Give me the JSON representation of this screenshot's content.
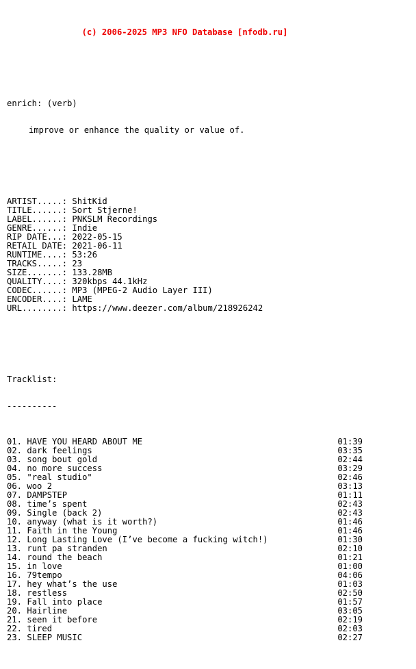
{
  "header": {
    "credit": "(c) 2006-2025 MP3 NFO Database [nfodb.ru]",
    "credit_color": "#ee0000"
  },
  "definition": {
    "word_line": "enrich: (verb)",
    "body_line": "improve or enhance the quality or value of."
  },
  "metadata": {
    "fields": [
      {
        "label": "ARTIST.....: ",
        "value": "ShitKid"
      },
      {
        "label": "TITLE......: ",
        "value": "Sort Stjerne!"
      },
      {
        "label": "LABEL......: ",
        "value": "PNKSLM Recordings"
      },
      {
        "label": "GENRE......: ",
        "value": "Indie"
      },
      {
        "label": "RIP DATE...: ",
        "value": "2022-05-15"
      },
      {
        "label": "RETAIL DATE: ",
        "value": "2021-06-11"
      },
      {
        "label": "RUNTIME....: ",
        "value": "53:26"
      },
      {
        "label": "TRACKS.....: ",
        "value": "23"
      },
      {
        "label": "SIZE.......: ",
        "value": "133.28MB"
      },
      {
        "label": "QUALITY....: ",
        "value": "320kbps 44.1kHz"
      },
      {
        "label": "CODEC......: ",
        "value": "MP3 (MPEG-2 Audio Layer III)"
      },
      {
        "label": "ENCODER....: ",
        "value": "LAME"
      },
      {
        "label": "URL........: ",
        "value": "https://www.deezer.com/album/218926242"
      }
    ]
  },
  "tracklist": {
    "title": "Tracklist:",
    "rule": "----------",
    "tracks": [
      {
        "num": "01. ",
        "name": "HAVE YOU HEARD ABOUT ME",
        "time": "01:39"
      },
      {
        "num": "02. ",
        "name": "dark feelings",
        "time": "03:35"
      },
      {
        "num": "03. ",
        "name": "song bout gold",
        "time": "02:44"
      },
      {
        "num": "04. ",
        "name": "no more success",
        "time": "03:29"
      },
      {
        "num": "05. ",
        "name": "\"real studio\"",
        "time": "02:46"
      },
      {
        "num": "06. ",
        "name": "woo 2",
        "time": "03:13"
      },
      {
        "num": "07. ",
        "name": "DAMPSTEP",
        "time": "01:11"
      },
      {
        "num": "08. ",
        "name": "time’s spent",
        "time": "02:43"
      },
      {
        "num": "09. ",
        "name": "Single (back 2)",
        "time": "02:43"
      },
      {
        "num": "10. ",
        "name": "anyway (what is it worth?)",
        "time": "01:46"
      },
      {
        "num": "11. ",
        "name": "Faith in the Young",
        "time": "01:46"
      },
      {
        "num": "12. ",
        "name": "Long Lasting Love (I’ve become a fucking witch!)",
        "time": "01:30"
      },
      {
        "num": "13. ",
        "name": "runt pa stranden",
        "time": "02:10"
      },
      {
        "num": "14. ",
        "name": "round the beach",
        "time": "01:21"
      },
      {
        "num": "15. ",
        "name": "in love",
        "time": "01:00"
      },
      {
        "num": "16. ",
        "name": "79tempo",
        "time": "04:06"
      },
      {
        "num": "17. ",
        "name": "hey what’s the use",
        "time": "01:03"
      },
      {
        "num": "18. ",
        "name": "restless",
        "time": "02:50"
      },
      {
        "num": "19. ",
        "name": "Fall into place",
        "time": "01:57"
      },
      {
        "num": "20. ",
        "name": "Hairline",
        "time": "03:05"
      },
      {
        "num": "21. ",
        "name": "seen it before",
        "time": "02:19"
      },
      {
        "num": "22. ",
        "name": "tired",
        "time": "02:03"
      },
      {
        "num": "23. ",
        "name": "SLEEP MUSIC",
        "time": "02:27"
      }
    ]
  }
}
